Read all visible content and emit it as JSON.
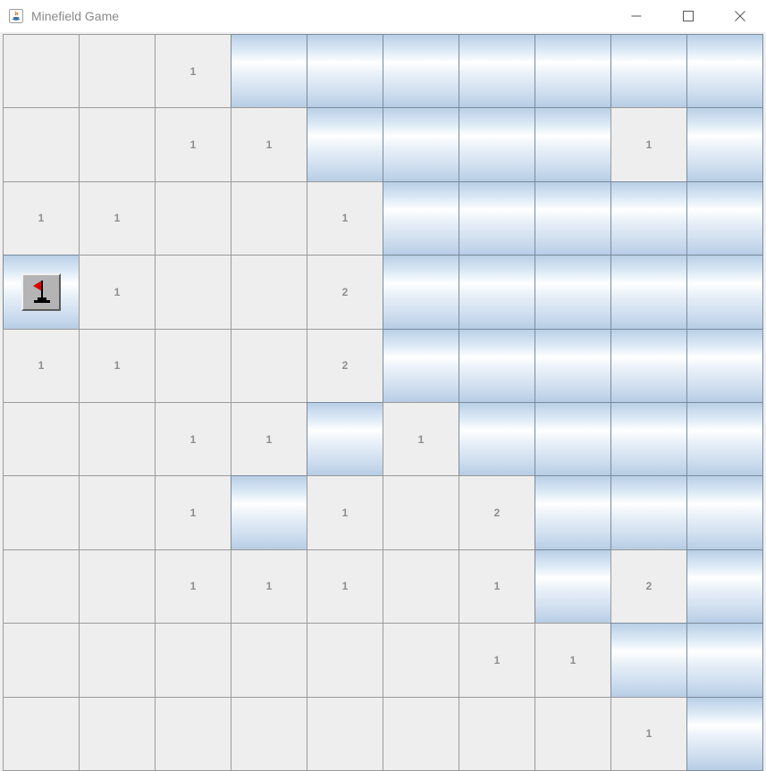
{
  "window": {
    "title": "Minefield Game",
    "controls": {
      "minimize": "minimize-icon",
      "maximize": "maximize-icon",
      "close": "close-icon"
    }
  },
  "board": {
    "rows": 10,
    "cols": 10,
    "legend": {
      "H": "hidden",
      "F": "flagged",
      "0": "open-empty",
      "1-8": "open-number"
    },
    "grid": [
      [
        "0",
        "0",
        "1",
        "H",
        "H",
        "H",
        "H",
        "H",
        "H",
        "H"
      ],
      [
        "0",
        "0",
        "1",
        "1",
        "H",
        "H",
        "H",
        "H",
        "1",
        "H"
      ],
      [
        "1",
        "1",
        "0",
        "0",
        "1",
        "H",
        "H",
        "H",
        "H",
        "H"
      ],
      [
        "F",
        "1",
        "0",
        "0",
        "2",
        "H",
        "H",
        "H",
        "H",
        "H"
      ],
      [
        "1",
        "1",
        "0",
        "0",
        "2",
        "H",
        "H",
        "H",
        "H",
        "H"
      ],
      [
        "0",
        "0",
        "1",
        "1",
        "H",
        "1",
        "H",
        "H",
        "H",
        "H"
      ],
      [
        "0",
        "0",
        "1",
        "H",
        "1",
        "0",
        "2",
        "H",
        "H",
        "H"
      ],
      [
        "0",
        "0",
        "1",
        "1",
        "1",
        "0",
        "1",
        "H",
        "2",
        "H"
      ],
      [
        "0",
        "0",
        "0",
        "0",
        "0",
        "0",
        "1",
        "1",
        "H",
        "H"
      ],
      [
        "0",
        "0",
        "0",
        "0",
        "0",
        "0",
        "0",
        "0",
        "1",
        "H"
      ]
    ]
  },
  "colors": {
    "open_cell": "#eeeeee",
    "hidden_cell_light": "#ffffff",
    "hidden_cell_dark": "#b9cfe6",
    "number_text": "#8e8e8e",
    "flag_red": "#e00000"
  }
}
